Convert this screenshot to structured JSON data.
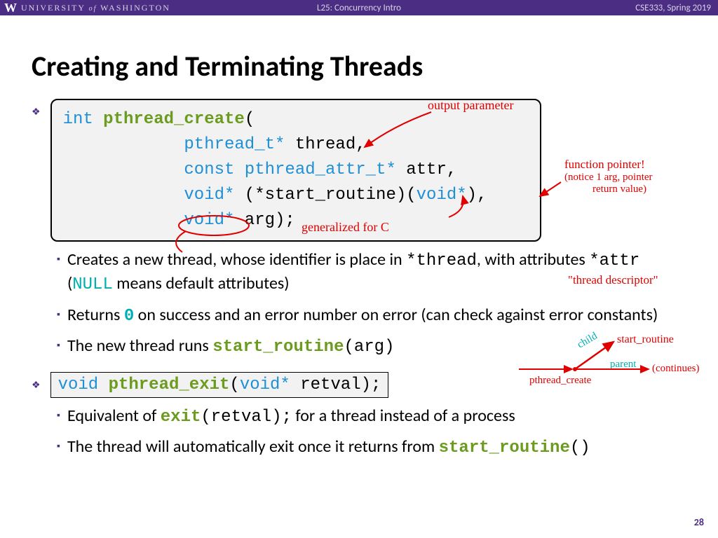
{
  "header": {
    "university_w": "W",
    "university_name1": "UNIVERSITY",
    "university_of": "of",
    "university_name2": "WASHINGTON",
    "lecture": "L25:  Concurrency Intro",
    "course": "CSE333, Spring 2019"
  },
  "title": "Creating and Terminating Threads",
  "code1": {
    "l1a": "int",
    "l1b": " pthread_create",
    "l1c": "(",
    "l2a": "            pthread_t*",
    "l2b": " thread,",
    "l3a": "            const",
    "l3b": " pthread_attr_t*",
    "l3c": " attr,",
    "l4a": "            void*",
    "l4b": " (*start_routine)(",
    "l4c": "void*",
    "l4d": "),",
    "l5a": "            void*",
    "l5b": " arg);"
  },
  "sub1": {
    "a1": "Creates a new thread, whose identifier is place in ",
    "a2": "*thread",
    "a3": ", with attributes ",
    "a4": "*attr",
    "a5": " (",
    "a6": "NULL",
    "a7": " means default attributes)",
    "b1": "Returns ",
    "b2": "0",
    "b3": " on success and an error number on error (can check against error constants)",
    "c1": "The new thread runs ",
    "c2": "start_routine",
    "c3": "(arg)"
  },
  "code2": {
    "a": "void",
    "b": " pthread_exit",
    "c": "(",
    "d": "void*",
    "e": " retval);"
  },
  "sub2": {
    "a1": "Equivalent of ",
    "a2": "exit",
    "a3": "(retval);",
    "a4": " for a thread instead of a process",
    "b1": "The thread will automatically exit once it returns from ",
    "b2": "start_routine",
    "b3": "()"
  },
  "annotations": {
    "output_param": "output parameter",
    "fn_ptr1": "function pointer!",
    "fn_ptr2": "(notice 1 arg, pointer",
    "fn_ptr3": "return value)",
    "generalized": "generalized for C",
    "thread_desc": "\"thread descriptor\"",
    "start_routine": "start_routine",
    "child": "child",
    "parent": "parent",
    "continues": "(continues)",
    "pthread_create": "pthread_create"
  },
  "pagenum": "28"
}
